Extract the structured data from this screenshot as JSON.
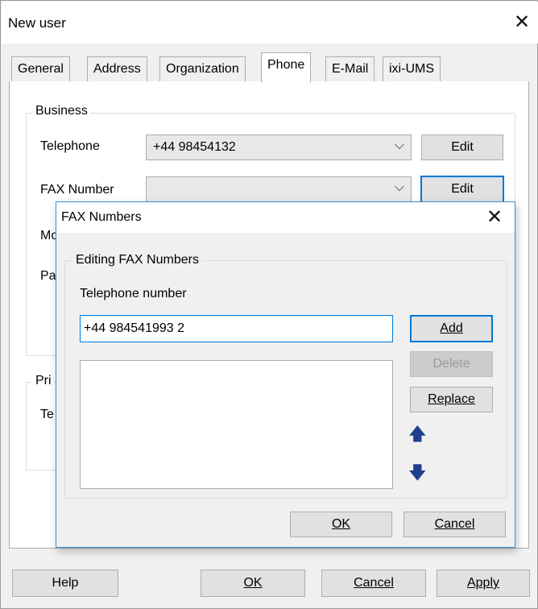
{
  "window": {
    "title": "New user",
    "close": "✕"
  },
  "tabs": [
    {
      "label": "General"
    },
    {
      "label": "Address"
    },
    {
      "label": "Organization"
    },
    {
      "label": "Phone",
      "active": true
    },
    {
      "label": "E-Mail"
    },
    {
      "label": "ixi-UMS"
    }
  ],
  "business": {
    "group_label": "Business",
    "telephone_label": "Telephone",
    "telephone_value": "+44 98454132",
    "fax_label": "FAX Number",
    "fax_value": "",
    "mobile_label_partial": "Mo",
    "pager_label_partial": "Pa",
    "edit_label": "Edit"
  },
  "private": {
    "group_label_partial": "Pri",
    "telephone_label_partial": "Te"
  },
  "fax_dialog": {
    "title": "FAX Numbers",
    "close": "✕",
    "group_label": "Editing FAX Numbers",
    "telephone_number_label": "Telephone number",
    "input_value": "+44 984541993 2",
    "add_label": "Add",
    "delete_label": "Delete",
    "replace_label": "Replace",
    "up_arrow": "🡅",
    "down_arrow": "🡇",
    "ok_label": "OK",
    "cancel_label": "Cancel",
    "list_items": []
  },
  "footer": {
    "help_label": "Help",
    "ok_label": "OK",
    "cancel_label": "Cancel",
    "apply_label": "Apply"
  },
  "colors": {
    "accent": "#0078d7",
    "arrow": "#1f3f8c"
  }
}
